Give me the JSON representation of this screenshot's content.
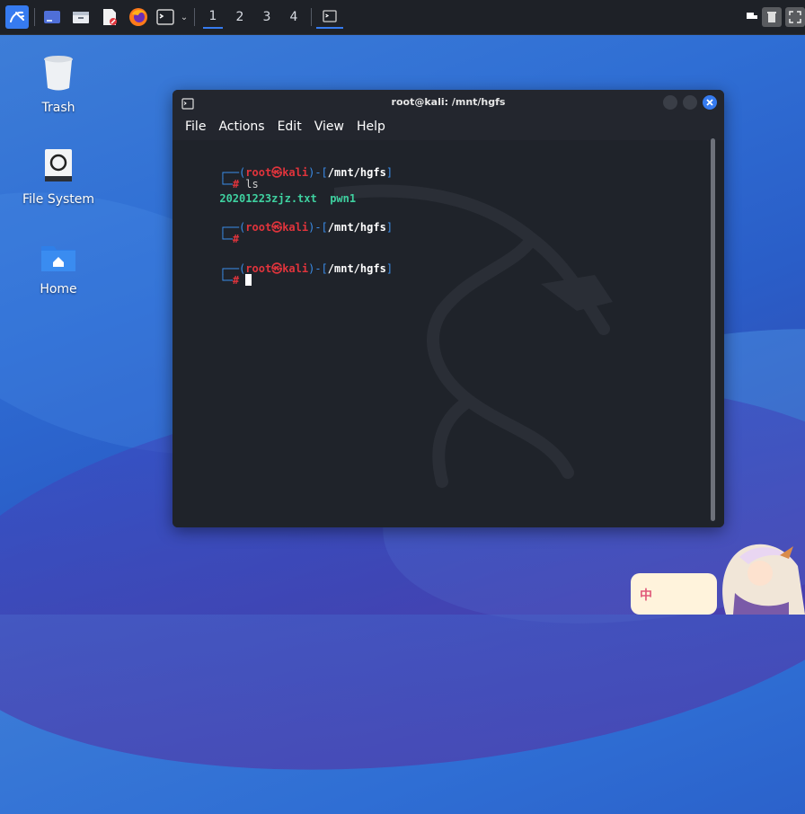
{
  "taskbar": {
    "workspaces": [
      "1",
      "2",
      "3",
      "4"
    ],
    "active_workspace": "1"
  },
  "desktop": {
    "icons": [
      {
        "label": "Trash"
      },
      {
        "label": "File System"
      },
      {
        "label": "Home"
      }
    ]
  },
  "terminal": {
    "title": "root@kali: /mnt/hgfs",
    "menu": [
      "File",
      "Actions",
      "Edit",
      "View",
      "Help"
    ],
    "prompt_user": "root",
    "prompt_at": "㉿",
    "prompt_host": "kali",
    "prompt_path": "/mnt/hgfs",
    "prompt_char": "#",
    "command1": "ls",
    "output": [
      "20201223zjz.txt",
      "pwn1"
    ]
  },
  "widget": {
    "text": "中"
  },
  "colors": {
    "accent": "#367bf0",
    "prompt_red": "#e0343c",
    "prompt_blue": "#3b8eea",
    "output_green": "#3fd1a0"
  }
}
